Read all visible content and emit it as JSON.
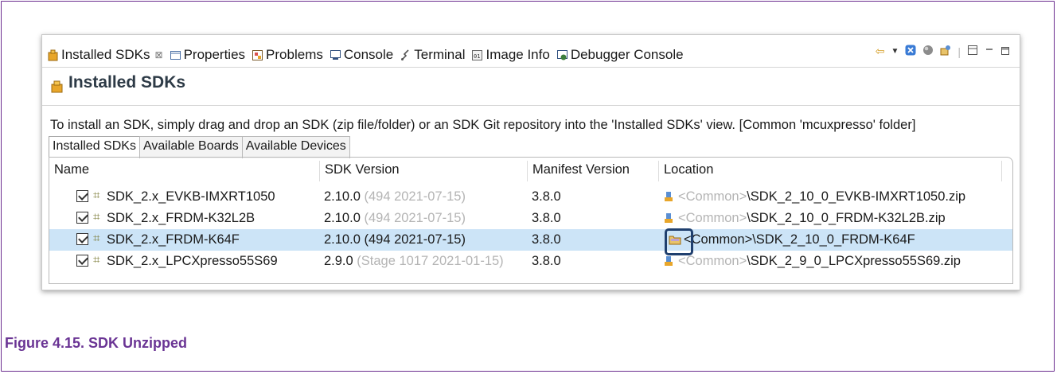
{
  "tabs": [
    {
      "label": "Installed SDKs",
      "active": true,
      "icon": "sdk-icon"
    },
    {
      "label": "Properties",
      "icon": "properties-icon"
    },
    {
      "label": "Problems",
      "icon": "problems-icon"
    },
    {
      "label": "Console",
      "icon": "console-icon"
    },
    {
      "label": "Terminal",
      "icon": "terminal-icon"
    },
    {
      "label": "Image Info",
      "icon": "image-info-icon"
    },
    {
      "label": "Debugger Console",
      "icon": "debugger-console-icon"
    }
  ],
  "tab_close_glyph": "☒",
  "view": {
    "title": "Installed SDKs",
    "description": "To install an SDK, simply drag and drop an SDK (zip file/folder) or an SDK Git repository into the 'Installed SDKs' view. [Common 'mcuxpresso' folder]"
  },
  "subtabs": [
    "Installed SDKs",
    "Available Boards",
    "Available Devices"
  ],
  "columns": [
    "Name",
    "SDK Version",
    "Manifest Version",
    "Location"
  ],
  "rows": [
    {
      "name": "SDK_2.x_EVKB-IMXRT1050",
      "version": "2.10.0",
      "build": "(494 2021-07-15)",
      "manifest": "3.8.0",
      "loc_prefix": "<Common>",
      "loc_path": "\\SDK_2_10_0_EVKB-IMXRT1050.zip"
    },
    {
      "name": "SDK_2.x_FRDM-K32L2B",
      "version": "2.10.0",
      "build": "(494 2021-07-15)",
      "manifest": "3.8.0",
      "loc_prefix": "<Common>",
      "loc_path": "\\SDK_2_10_0_FRDM-K32L2B.zip"
    },
    {
      "name": "SDK_2.x_FRDM-K64F",
      "version": "2.10.0",
      "build": "(494 2021-07-15)",
      "manifest": "3.8.0",
      "loc_prefix": "<Common>",
      "loc_path": "\\SDK_2_10_0_FRDM-K64F"
    },
    {
      "name": "SDK_2.x_LPCXpresso55S69",
      "version": "2.9.0",
      "build": "(Stage 1017 2021-01-15)",
      "manifest": "3.8.0",
      "loc_prefix": "<Common>",
      "loc_path": "\\SDK_2_9_0_LPCXpresso55S69.zip"
    }
  ],
  "caption": "Figure 4.15. SDK Unzipped",
  "colors": {
    "accent": "#6a3494",
    "selection": "#cce4f7",
    "highlight": "#1f3f6e"
  }
}
